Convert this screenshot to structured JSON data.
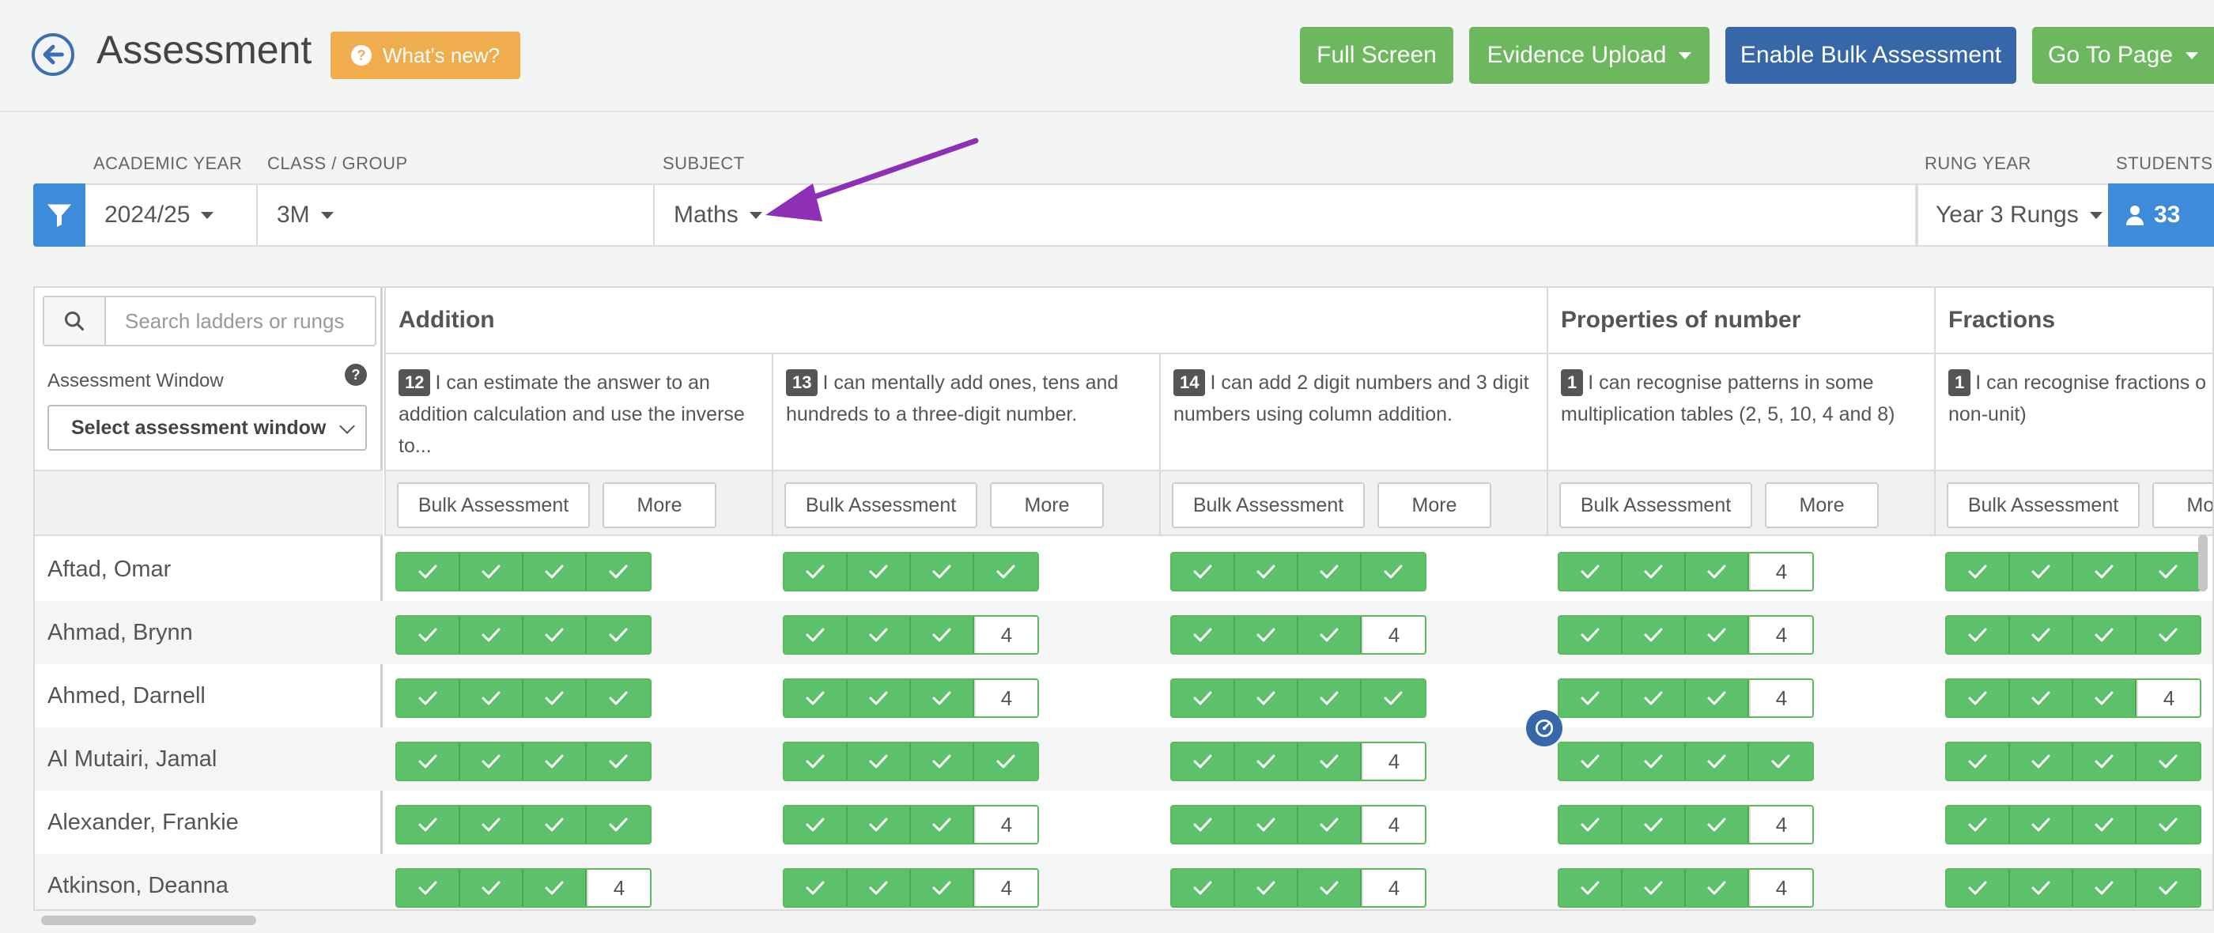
{
  "header": {
    "title": "Assessment",
    "whats_new": "What's new?",
    "buttons": {
      "full_screen": "Full Screen",
      "evidence_upload": "Evidence Upload",
      "enable_bulk": "Enable Bulk Assessment",
      "go_to_page": "Go To Page"
    }
  },
  "filters": {
    "academic_year_label": "ACADEMIC YEAR",
    "academic_year": "2024/25",
    "class_label": "CLASS / GROUP",
    "class": "3M",
    "subject_label": "SUBJECT",
    "subject": "Maths",
    "rung_year_label": "RUNG YEAR",
    "rung_year": "Year 3 Rungs",
    "students_label": "STUDENTS",
    "students": "33"
  },
  "grid": {
    "search_placeholder": "Search ladders or rungs",
    "assessment_window_label": "Assessment Window",
    "assessment_window_help": "?",
    "assessment_window_select": "Select assessment window",
    "bulk_label": "Bulk Assessment",
    "more_label": "More",
    "ladders": [
      "Addition",
      "Properties of number",
      "Fractions"
    ],
    "rungs": [
      {
        "num": "12",
        "text": "I can estimate the answer to an addition calculation and use the inverse to..."
      },
      {
        "num": "13",
        "text": "I can mentally add ones, tens and hundreds to a three-digit number."
      },
      {
        "num": "14",
        "text": "I can add 2 digit numbers and 3 digit numbers using column addition."
      },
      {
        "num": "1",
        "text": "I can recognise patterns in some multiplication tables (2, 5, 10, 4 and 8)"
      },
      {
        "num": "1",
        "text": "I can recognise fractions o (unit and non-unit)"
      }
    ],
    "students": [
      {
        "name": "Aftad, Omar",
        "levels": [
          4,
          4,
          4,
          3,
          4
        ]
      },
      {
        "name": "Ahmad, Brynn",
        "levels": [
          4,
          3,
          3,
          3,
          4
        ]
      },
      {
        "name": "Ahmed, Darnell",
        "levels": [
          4,
          3,
          4,
          3,
          3
        ]
      },
      {
        "name": "Al Mutairi, Jamal",
        "levels": [
          4,
          4,
          3,
          4,
          4
        ]
      },
      {
        "name": "Alexander, Frankie",
        "levels": [
          4,
          3,
          3,
          3,
          4
        ]
      },
      {
        "name": "Atkinson, Deanna",
        "levels": [
          3,
          3,
          3,
          3,
          4
        ]
      }
    ],
    "unfilled_label": "4"
  },
  "colors": {
    "green": "#5cc16a",
    "blue": "#3767a8",
    "orange": "#f0ad4e",
    "arrow": "#8e2fb5"
  }
}
